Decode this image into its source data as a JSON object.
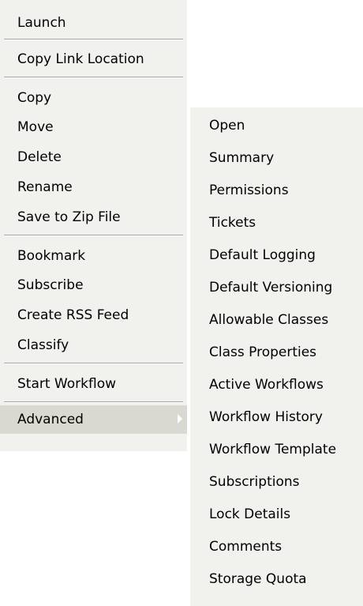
{
  "main_menu": {
    "items": [
      {
        "label": "Launch"
      },
      {
        "label": "Copy Link Location"
      },
      {
        "label": "Copy"
      },
      {
        "label": "Move"
      },
      {
        "label": "Delete"
      },
      {
        "label": "Rename"
      },
      {
        "label": "Save to Zip File"
      },
      {
        "label": "Bookmark"
      },
      {
        "label": "Subscribe"
      },
      {
        "label": "Create RSS Feed"
      },
      {
        "label": "Classify"
      },
      {
        "label": "Start Workflow"
      },
      {
        "label": "Advanced",
        "submenu_open": true,
        "icon": "chevron-right-icon"
      }
    ]
  },
  "sub_menu": {
    "items": [
      {
        "label": "Open"
      },
      {
        "label": "Summary"
      },
      {
        "label": "Permissions"
      },
      {
        "label": "Tickets"
      },
      {
        "label": "Default Logging"
      },
      {
        "label": "Default Versioning"
      },
      {
        "label": "Allowable Classes"
      },
      {
        "label": "Class Properties"
      },
      {
        "label": "Active Workflows"
      },
      {
        "label": "Workflow History"
      },
      {
        "label": "Workflow Template"
      },
      {
        "label": "Subscriptions"
      },
      {
        "label": "Lock Details"
      },
      {
        "label": "Comments"
      },
      {
        "label": "Storage Quota"
      }
    ]
  },
  "colors": {
    "menu_background": "#f1f1ee",
    "highlight": "#d9d8d1",
    "separator": "#a7a6aa"
  }
}
